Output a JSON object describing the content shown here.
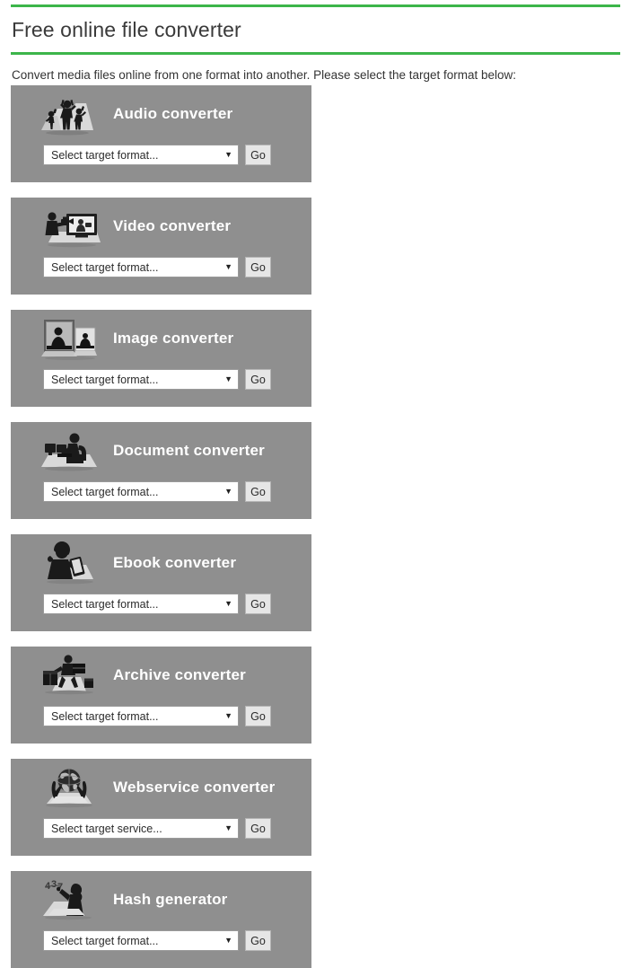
{
  "header": {
    "title": "Free online file converter",
    "intro": "Convert media files online from one format into another. Please select the target format below:",
    "accent_color": "#3cb54a"
  },
  "theme": {
    "card_background": "#8f8f8f",
    "card_title_color": "#ffffff",
    "page_background": "#ffffff",
    "button_background": "#e6e6e6"
  },
  "cards": [
    {
      "title": "Audio converter",
      "icon": "audio-dancers-icon",
      "select_value": "Select target format...",
      "button_label": "Go"
    },
    {
      "title": "Video converter",
      "icon": "video-camera-monitor-icon",
      "select_value": "Select target format...",
      "button_label": "Go"
    },
    {
      "title": "Image converter",
      "icon": "image-frames-icon",
      "select_value": "Select target format...",
      "button_label": "Go"
    },
    {
      "title": "Document converter",
      "icon": "document-desk-worker-icon",
      "select_value": "Select target format...",
      "button_label": "Go"
    },
    {
      "title": "Ebook converter",
      "icon": "ebook-reader-icon",
      "select_value": "Select target format...",
      "button_label": "Go"
    },
    {
      "title": "Archive converter",
      "icon": "archive-boxes-icon",
      "select_value": "Select target format...",
      "button_label": "Go"
    },
    {
      "title": "Webservice converter",
      "icon": "webservice-globe-hands-icon",
      "select_value": "Select target service...",
      "button_label": "Go"
    },
    {
      "title": "Hash generator",
      "icon": "hash-writer-icon",
      "select_value": "Select target format...",
      "button_label": "Go"
    }
  ]
}
